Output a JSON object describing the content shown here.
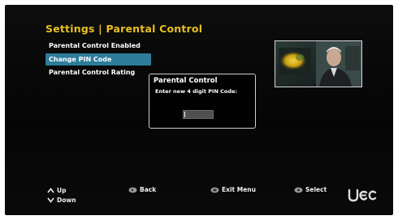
{
  "screen": {
    "title": "Settings | Parental Control"
  },
  "menu": {
    "items": [
      {
        "label": "Parental Control Enabled",
        "selected": false
      },
      {
        "label": "Change PIN Code",
        "selected": true
      },
      {
        "label": "Parental Control Rating",
        "selected": false
      }
    ]
  },
  "dialog": {
    "title": "Parental Control",
    "prompt": "Enter new 4 digit PIN Code:",
    "pin_value": ""
  },
  "footer": {
    "up": "Up",
    "down": "Down",
    "back": "Back",
    "exit": "Exit Menu",
    "select": "Select"
  },
  "icons": {
    "up": "chevron-up-icon",
    "down": "chevron-down-icon",
    "back": "remote-key-icon",
    "exit": "remote-key-icon",
    "select": "remote-key-icon",
    "logo": "brand-logo"
  },
  "colors": {
    "title": "#e8c020",
    "selected_item": "#2d7d9a",
    "background": "#050505",
    "text": "#ffffff"
  }
}
